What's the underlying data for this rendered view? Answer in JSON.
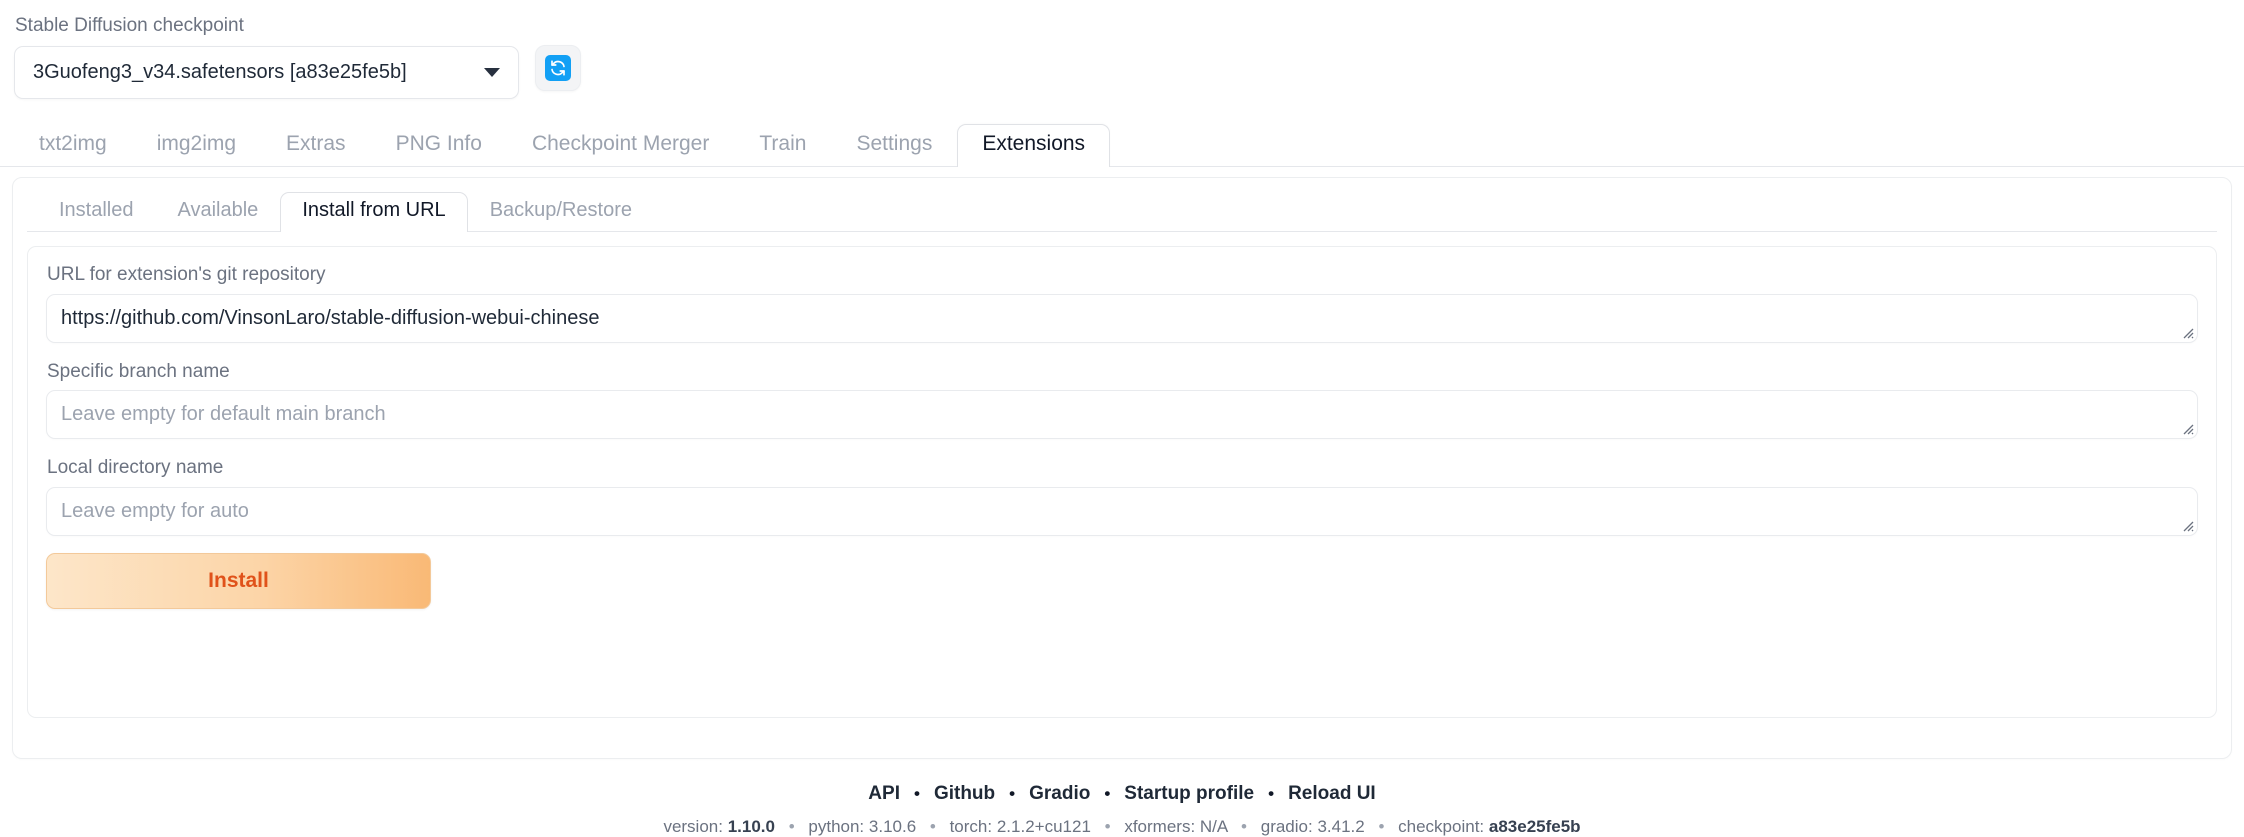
{
  "checkpoint": {
    "label": "Stable Diffusion checkpoint",
    "value": "3Guofeng3_v34.safetensors [a83e25fe5b]",
    "refresh_icon": "refresh-icon",
    "caret_icon": "chevron-down-icon"
  },
  "main_tabs": [
    {
      "label": "txt2img",
      "active": false
    },
    {
      "label": "img2img",
      "active": false
    },
    {
      "label": "Extras",
      "active": false
    },
    {
      "label": "PNG Info",
      "active": false
    },
    {
      "label": "Checkpoint Merger",
      "active": false
    },
    {
      "label": "Train",
      "active": false
    },
    {
      "label": "Settings",
      "active": false
    },
    {
      "label": "Extensions",
      "active": true
    }
  ],
  "sub_tabs": [
    {
      "label": "Installed",
      "active": false
    },
    {
      "label": "Available",
      "active": false
    },
    {
      "label": "Install from URL",
      "active": true
    },
    {
      "label": "Backup/Restore",
      "active": false
    }
  ],
  "form": {
    "url_field": {
      "label": "URL for extension's git repository",
      "value": "https://github.com/VinsonLaro/stable-diffusion-webui-chinese",
      "placeholder": ""
    },
    "branch_field": {
      "label": "Specific branch name",
      "value": "",
      "placeholder": "Leave empty for default main branch"
    },
    "dir_field": {
      "label": "Local directory name",
      "value": "",
      "placeholder": "Leave empty for auto"
    },
    "install_button": "Install"
  },
  "footer": {
    "links": [
      "API",
      "Github",
      "Gradio",
      "Startup profile",
      "Reload UI"
    ],
    "separator": "•",
    "version": {
      "version_label": "version:",
      "version_value": "1.10.0",
      "python_label": "python:",
      "python_value": "3.10.6",
      "torch_label": "torch:",
      "torch_value": "2.1.2+cu121",
      "xformers_label": "xformers:",
      "xformers_value": "N/A",
      "gradio_label": "gradio:",
      "gradio_value": "3.41.2",
      "checkpoint_label": "checkpoint:",
      "checkpoint_value": "a83e25fe5b"
    }
  },
  "colors": {
    "accent_blue": "#12a0f5",
    "install_text": "#e0521a",
    "install_gradient_start": "#fde6c9",
    "install_gradient_end": "#f9b976",
    "text_muted": "#9ca3af",
    "text_dark": "#1f2937"
  }
}
